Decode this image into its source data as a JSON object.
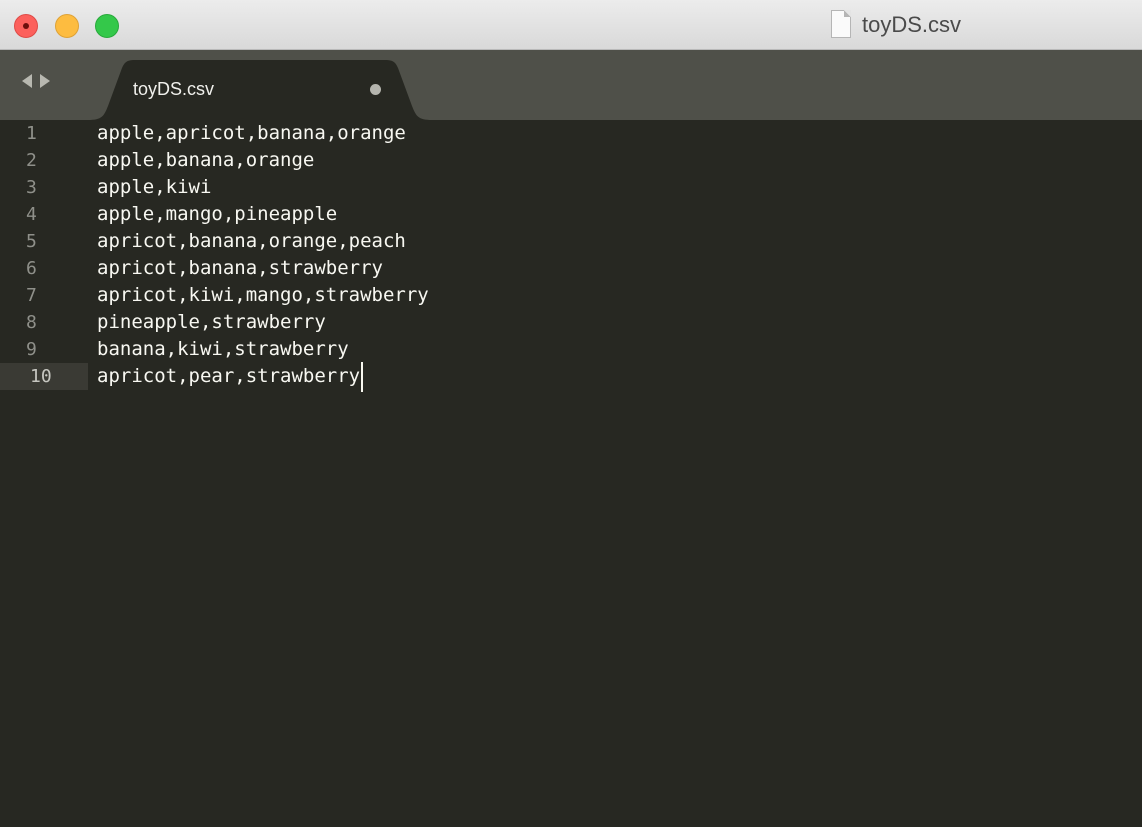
{
  "window": {
    "title": "toyDS.csv",
    "traffic_lights": {
      "close_color": "#fc605c",
      "minimize_color": "#fdbc40",
      "maximize_color": "#34c84a"
    }
  },
  "tabbar": {
    "nav_icons": [
      "chevron-left-icon",
      "chevron-right-icon"
    ],
    "tabs": [
      {
        "label": "toyDS.csv",
        "active": true,
        "unsaved": true
      }
    ]
  },
  "editor": {
    "lines": [
      {
        "number": "1",
        "text": "apple,apricot,banana,orange"
      },
      {
        "number": "2",
        "text": "apple,banana,orange"
      },
      {
        "number": "3",
        "text": "apple,kiwi"
      },
      {
        "number": "4",
        "text": "apple,mango,pineapple"
      },
      {
        "number": "5",
        "text": "apricot,banana,orange,peach"
      },
      {
        "number": "6",
        "text": "apricot,banana,strawberry"
      },
      {
        "number": "7",
        "text": "apricot,kiwi,mango,strawberry"
      },
      {
        "number": "8",
        "text": "pineapple,strawberry"
      },
      {
        "number": "9",
        "text": "banana,kiwi,strawberry"
      },
      {
        "number": "10",
        "text": "apricot,pear,strawberry"
      }
    ],
    "active_line": "10",
    "colors": {
      "background": "#272822",
      "text": "#f8f8f2",
      "gutter_text": "#8f908a",
      "tabbar": "#4f5049"
    }
  }
}
